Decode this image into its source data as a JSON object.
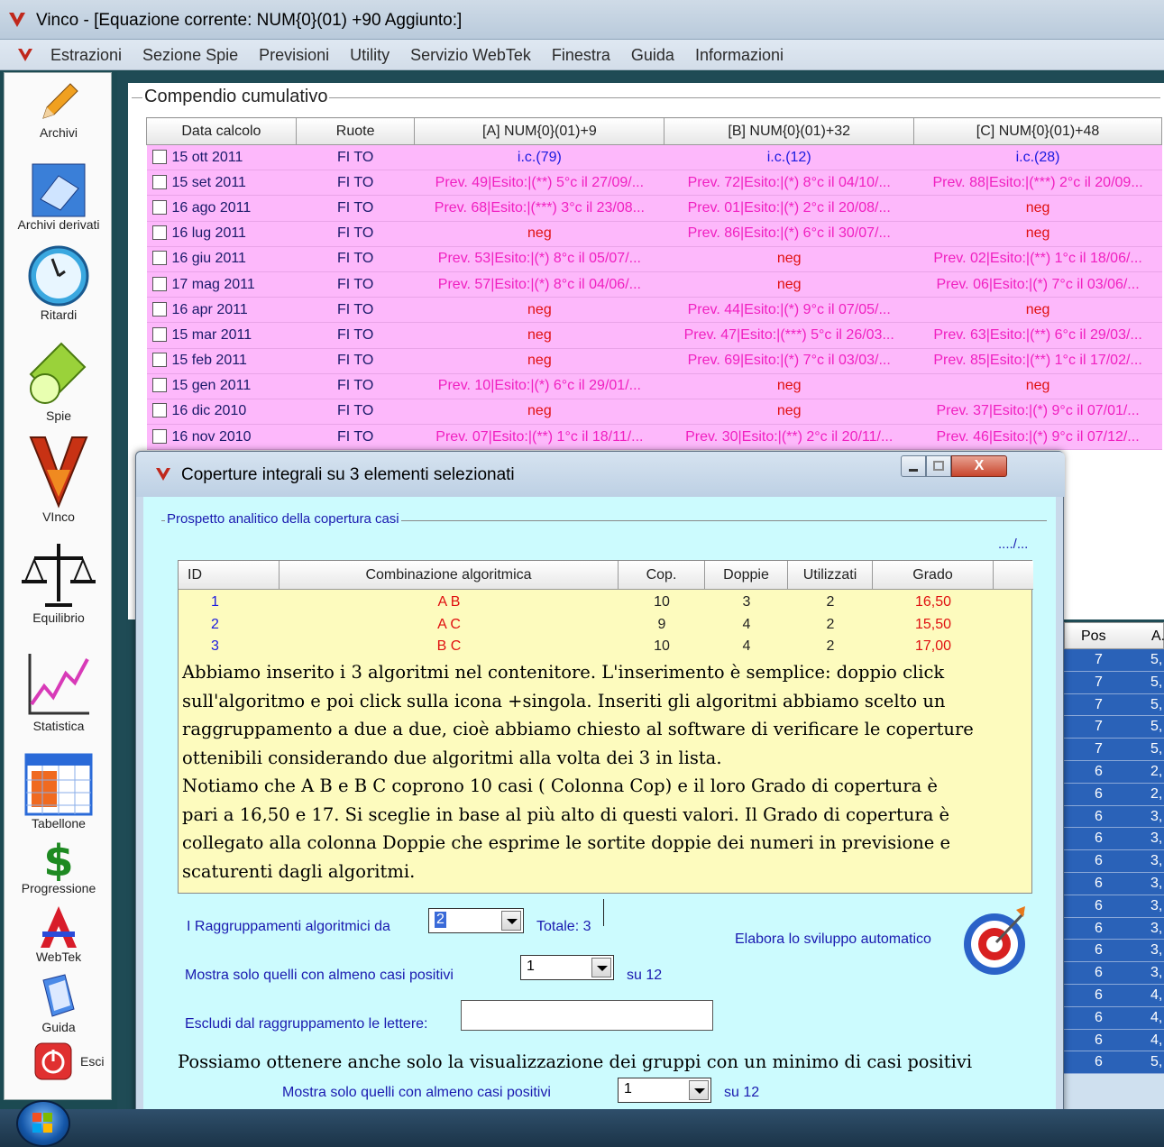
{
  "window": {
    "title": "Vinco - [Equazione corrente: NUM{0}(01) +90 Aggiunto:]"
  },
  "menu": [
    "Estrazioni",
    "Sezione Spie",
    "Previsioni",
    "Utility",
    "Servizio WebTek",
    "Finestra",
    "Guida",
    "Informazioni"
  ],
  "sidebar": {
    "archivi": "Archivi",
    "archivi_derivati": "Archivi derivati",
    "ritardi": "Ritardi",
    "spie": "Spie",
    "vinco": "VInco",
    "equilibrio": "Equilibrio",
    "statistica": "Statistica",
    "tabellone": "Tabellone",
    "progressione": "Progressione",
    "webtek": "WebTek",
    "guida": "Guida",
    "esci": "Esci"
  },
  "compendio": {
    "title": "Compendio cumulativo",
    "headers": [
      "Data calcolo",
      "Ruote",
      "[A] NUM{0}(01)+9",
      "[B] NUM{0}(01)+32",
      "[C] NUM{0}(01)+48"
    ],
    "rows": [
      {
        "date": "15 ott 2011",
        "ruote": "FI TO",
        "a": "i.c.(79)",
        "b": "i.c.(12)",
        "c": "i.c.(28)"
      },
      {
        "date": "15 set 2011",
        "ruote": "FI TO",
        "a": "Prev. 49|Esito:|(**) 5°c il 27/09/...",
        "b": "Prev. 72|Esito:|(*) 8°c il 04/10/...",
        "c": "Prev. 88|Esito:|(***) 2°c il 20/09..."
      },
      {
        "date": "16 ago 2011",
        "ruote": "FI TO",
        "a": "Prev. 68|Esito:|(***) 3°c il 23/08...",
        "b": "Prev. 01|Esito:|(*) 2°c il 20/08/...",
        "c": "neg"
      },
      {
        "date": "16 lug 2011",
        "ruote": "FI TO",
        "a": "neg",
        "b": "Prev. 86|Esito:|(*) 6°c il 30/07/...",
        "c": "neg"
      },
      {
        "date": "16 giu 2011",
        "ruote": "FI TO",
        "a": "Prev. 53|Esito:|(*) 8°c il 05/07/...",
        "b": "neg",
        "c": "Prev. 02|Esito:|(**) 1°c il 18/06/..."
      },
      {
        "date": "17 mag 2011",
        "ruote": "FI TO",
        "a": "Prev. 57|Esito:|(*) 8°c il 04/06/...",
        "b": "neg",
        "c": "Prev. 06|Esito:|(*) 7°c il 03/06/..."
      },
      {
        "date": "16 apr 2011",
        "ruote": "FI TO",
        "a": "neg",
        "b": "Prev. 44|Esito:|(*) 9°c il 07/05/...",
        "c": "neg"
      },
      {
        "date": "15 mar 2011",
        "ruote": "FI TO",
        "a": "neg",
        "b": "Prev. 47|Esito:|(***) 5°c il 26/03...",
        "c": "Prev. 63|Esito:|(**) 6°c il 29/03/..."
      },
      {
        "date": "15 feb 2011",
        "ruote": "FI TO",
        "a": "neg",
        "b": "Prev. 69|Esito:|(*) 7°c il 03/03/...",
        "c": "Prev. 85|Esito:|(**) 1°c il 17/02/..."
      },
      {
        "date": "15 gen 2011",
        "ruote": "FI TO",
        "a": "Prev. 10|Esito:|(*) 6°c il 29/01/...",
        "b": "neg",
        "c": "neg"
      },
      {
        "date": "16 dic 2010",
        "ruote": "FI TO",
        "a": "neg",
        "b": "neg",
        "c": "Prev. 37|Esito:|(*) 9°c il 07/01/..."
      },
      {
        "date": "16 nov 2010",
        "ruote": "FI TO",
        "a": "Prev. 07|Esito:|(**) 1°c il 18/11/...",
        "b": "Prev. 30|Esito:|(**) 2°c il 20/11/...",
        "c": "Prev. 46|Esito:|(*) 9°c il 07/12/..."
      }
    ]
  },
  "right_table": {
    "headers": [
      "Pos",
      "A."
    ],
    "rows": [
      [
        "7",
        "5,"
      ],
      [
        "7",
        "5,"
      ],
      [
        "7",
        "5,"
      ],
      [
        "7",
        "5,"
      ],
      [
        "7",
        "5,"
      ],
      [
        "6",
        "2,"
      ],
      [
        "6",
        "2,"
      ],
      [
        "6",
        "3,"
      ],
      [
        "6",
        "3,"
      ],
      [
        "6",
        "3,"
      ],
      [
        "6",
        "3,"
      ],
      [
        "6",
        "3,"
      ],
      [
        "6",
        "3,"
      ],
      [
        "6",
        "3,"
      ],
      [
        "6",
        "3,"
      ],
      [
        "6",
        "4,"
      ],
      [
        "6",
        "4,"
      ],
      [
        "6",
        "4,"
      ],
      [
        "6",
        "5,"
      ]
    ]
  },
  "dialog": {
    "title": "Coperture integrali su 3 elementi selezionati",
    "close_label": "X",
    "fieldset_title": "Prospetto analitico della copertura casi",
    "dots": "..../...",
    "grid_headers": [
      "ID",
      "Combinazione algoritmica",
      "Cop.",
      "Doppie",
      "Utilizzati",
      "Grado"
    ],
    "grid_rows": [
      {
        "id": "1",
        "comb": "A B",
        "cop": "10",
        "doppie": "3",
        "util": "2",
        "grado": "16,50"
      },
      {
        "id": "2",
        "comb": "A C",
        "cop": "9",
        "doppie": "4",
        "util": "2",
        "grado": "15,50"
      },
      {
        "id": "3",
        "comb": "B C",
        "cop": "10",
        "doppie": "4",
        "util": "2",
        "grado": "17,00"
      }
    ],
    "note_lines": [
      "Abbiamo inserito i 3 algoritmi nel contenitore. L'inserimento è semplice: doppio click",
      "sull'algoritmo e poi click sulla icona +singola. Inseriti gli algoritmi abbiamo scelto un",
      "raggruppamento a due a due, cioè abbiamo chiesto al software di verificare le coperture",
      "ottenibili considerando due algoritmi alla volta dei 3 in lista.",
      "Notiamo che A B e B C coprono 10 casi ( Colonna Cop) e il loro Grado di copertura è",
      "pari a 16,50 e 17. Si sceglie in base al più alto di questi valori. Il Grado di copertura è",
      "collegato alla colonna Doppie che esprime le sortite doppie dei numeri in previsione e",
      "scaturenti dagli algoritmi."
    ],
    "raggruppamenti_label": "I  Raggruppamenti algoritmici da",
    "raggruppamenti_value": "2",
    "totale_label": "Totale: 3",
    "elabora_label": "Elabora lo sviluppo automatico",
    "mostra_label": "Mostra solo quelli con almeno casi positivi",
    "mostra_value": "1",
    "su_label": "su 12",
    "escludi_label": "Escludi dal raggruppamento le lettere:",
    "escludi_value": "",
    "big_note": "Possiamo ottenere anche solo la visualizzazione dei gruppi con un minimo di casi positivi",
    "mostra2_label": "Mostra solo quelli con almeno casi positivi",
    "mostra2_value": "1",
    "su2_label": "su 12"
  },
  "colors": {
    "row_pink": "#fdb8fb",
    "neg_red": "#e01010",
    "ic_blue": "#1a1ae0",
    "prev_magenta": "#f020c0",
    "dialog_bg": "#ccfbfe",
    "grid_yellow": "#fdfbbe"
  }
}
